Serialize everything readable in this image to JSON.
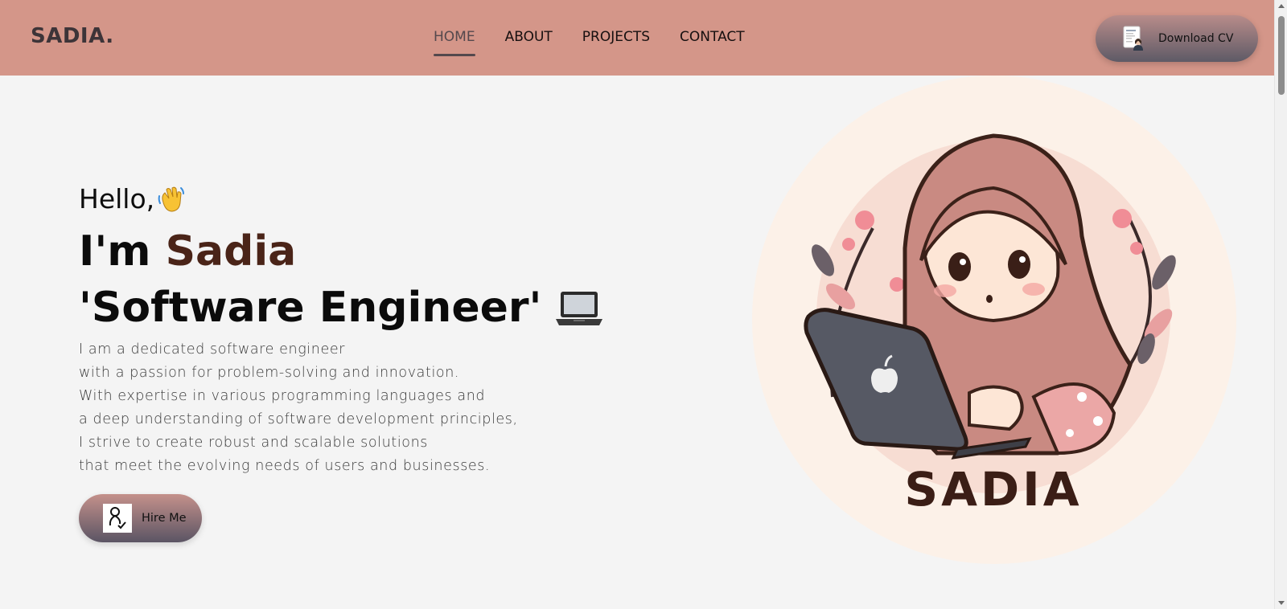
{
  "header": {
    "logo": "SADIA.",
    "nav": [
      {
        "label": "HOME",
        "active": true
      },
      {
        "label": "ABOUT",
        "active": false
      },
      {
        "label": "PROJECTS",
        "active": false
      },
      {
        "label": "CONTACT",
        "active": false
      }
    ],
    "cv_button_label": "Download CV"
  },
  "hero": {
    "greeting": "Hello,",
    "intro_prefix": "I'm ",
    "name": "Sadia",
    "role": "'Software Engineer'",
    "bio_lines": [
      "I am a dedicated software engineer",
      "with a passion for problem-solving and innovation.",
      "With expertise in various programming languages and",
      "a deep understanding of software development principles,",
      "I strive to create robust and scalable solutions",
      "that meet the evolving needs of users and businesses."
    ],
    "hire_button_label": "Hire Me"
  },
  "avatar": {
    "caption": "SADIA",
    "icon": "hijabi-girl-laptop-illustration"
  },
  "colors": {
    "navbar": "#d49689",
    "name_accent": "#4a2418",
    "page_bg": "#f4f4f4"
  }
}
